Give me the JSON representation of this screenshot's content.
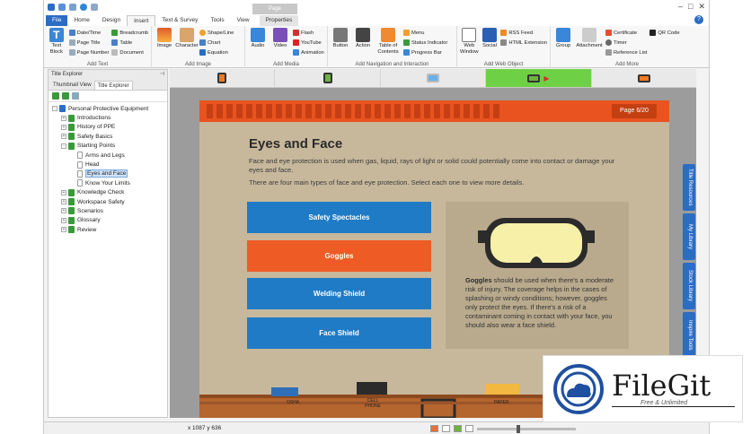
{
  "titlebar": {
    "context_tab": "Page"
  },
  "tabs": [
    "File",
    "Home",
    "Design",
    "Insert",
    "Text & Survey",
    "Tools",
    "View",
    "Properties"
  ],
  "ribbon": {
    "add_text": {
      "label": "Add Text",
      "text_block": "Text Block",
      "date_time": "Date/Time",
      "page_title": "Page Title",
      "page_number": "Page Number",
      "breadcrumb": "Breadcrumb",
      "table": "Table",
      "document": "Document"
    },
    "add_image": {
      "label": "Add Image",
      "image": "Image",
      "character": "Character",
      "shape_line": "Shape/Line",
      "chart": "Chart",
      "equation": "Equation"
    },
    "add_media": {
      "label": "Add Media",
      "audio": "Audio",
      "video": "Video",
      "flash": "Flash",
      "youtube": "YouTube",
      "animation": "Animation"
    },
    "add_nav": {
      "label": "Add Navigation and Interaction",
      "button": "Button",
      "action": "Action",
      "toc": "Table of Contents",
      "menu": "Menu",
      "status_indicator": "Status Indicator",
      "progress_bar": "Progress Bar"
    },
    "add_web": {
      "label": "Add Web Object",
      "web_window": "Web Window",
      "social": "Social",
      "rss": "RSS Feed",
      "html_ext": "HTML Extension"
    },
    "add_more": {
      "label": "Add More",
      "group": "Group",
      "attachment": "Attachment",
      "certificate": "Certificate",
      "timer": "Timer",
      "reference_list": "Reference List",
      "qr": "QR Code"
    }
  },
  "explorer": {
    "title": "Title Explorer",
    "tabs": [
      "Thumbnail View",
      "Title Explorer"
    ],
    "root": "Personal Protective Equipment",
    "items": [
      {
        "label": "Introductions",
        "level": 1,
        "exp": "+"
      },
      {
        "label": "History of PPE",
        "level": 1,
        "exp": "+"
      },
      {
        "label": "Safety Basics",
        "level": 1,
        "exp": "+"
      },
      {
        "label": "Starting Points",
        "level": 1,
        "exp": "-"
      },
      {
        "label": "Arms and Legs",
        "level": 2,
        "exp": ""
      },
      {
        "label": "Head",
        "level": 2,
        "exp": ""
      },
      {
        "label": "Eyes and Face",
        "level": 2,
        "exp": "",
        "selected": true
      },
      {
        "label": "Know Your Limits",
        "level": 2,
        "exp": ""
      },
      {
        "label": "Knowledge Check",
        "level": 1,
        "exp": "+"
      },
      {
        "label": "Workspace Safety",
        "level": 1,
        "exp": "+"
      },
      {
        "label": "Scenarios",
        "level": 1,
        "exp": "+"
      },
      {
        "label": "Glossary",
        "level": 1,
        "exp": "+"
      },
      {
        "label": "Review",
        "level": 1,
        "exp": "+"
      }
    ]
  },
  "slide": {
    "page_badge": "Page 6/20",
    "title": "Eyes and Face",
    "para1": "Face and eye protection is used when gas, liquid, rays of light or solid could potentially come into contact or damage your eyes and face.",
    "para2": "There are four main types of face and eye protection. Select each one to view more details.",
    "buttons": [
      {
        "label": "Safety Spectacles",
        "color": "blue"
      },
      {
        "label": "Goggles",
        "color": "orange"
      },
      {
        "label": "Welding Shield",
        "color": "blue"
      },
      {
        "label": "Face Shield",
        "color": "blue"
      }
    ],
    "panel_bold": "Goggles",
    "panel_text": " should be used when there's a moderate risk of injury. The coverage helps in the cases of splashing or windy conditions; however, goggles only protect the eyes. If there's a risk of a contaminant coming in contact with your face, you should also wear a face shield.",
    "shelf_labels": [
      "OSHA",
      "CELL PHONE",
      "PAPER"
    ]
  },
  "right_dock": [
    "Title Resources",
    "My Library",
    "Stock Library",
    "Inspire Tools"
  ],
  "status": {
    "coords": "x 1087 y 636"
  },
  "watermark": {
    "name": "FileGit",
    "tagline": "Free & Unlimited"
  },
  "colors": {
    "accent": "#2b6cc4",
    "orange": "#e8531f",
    "blue_btn": "#1f7bc6",
    "green_active": "#6ed145"
  }
}
